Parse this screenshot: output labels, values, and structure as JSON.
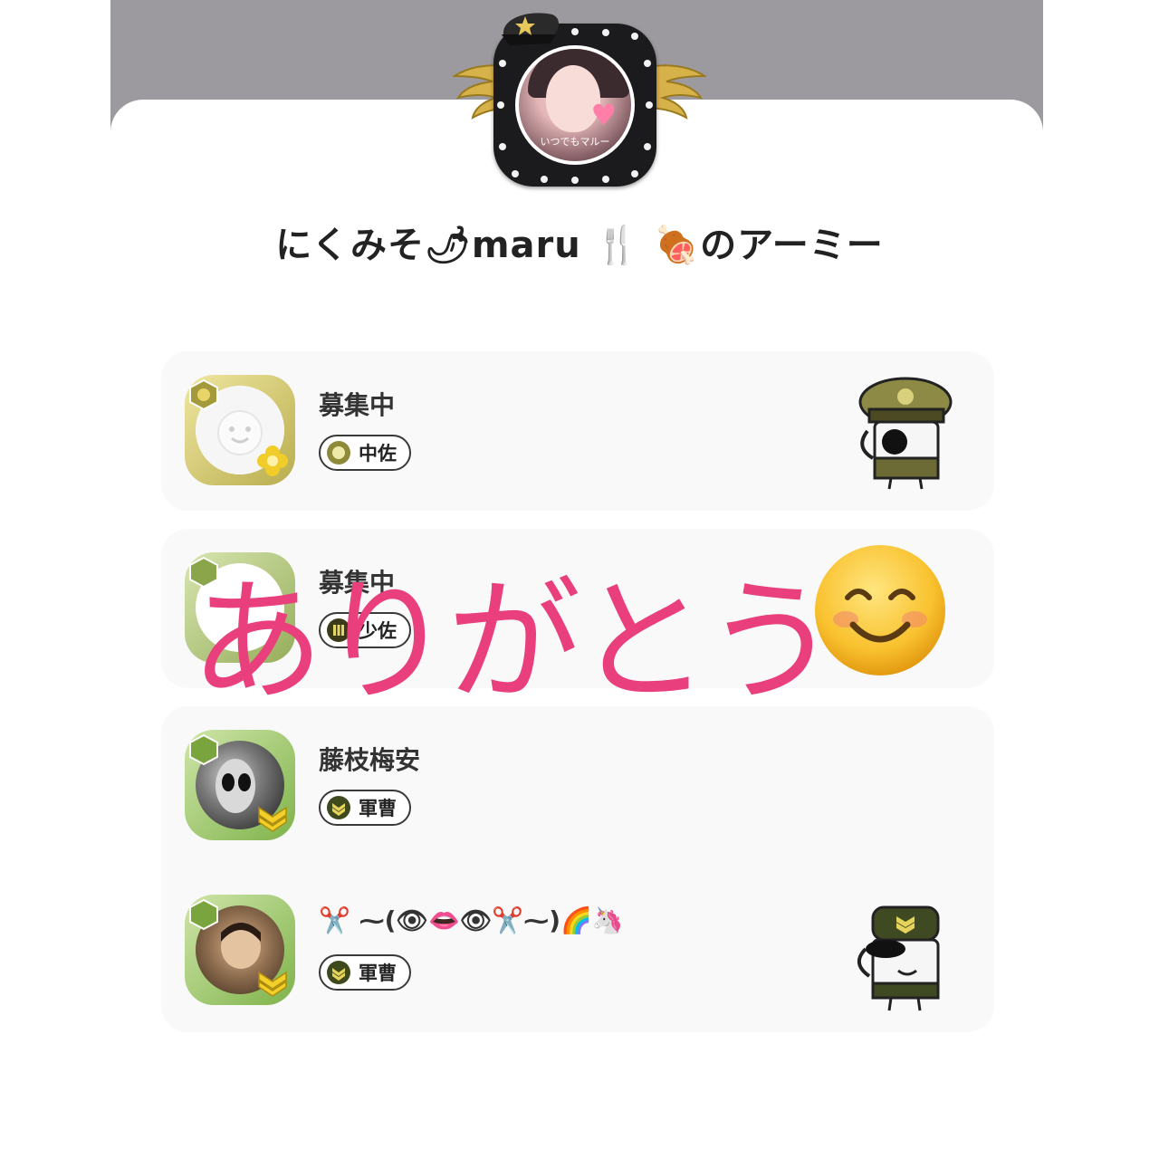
{
  "army_title": "にくみそ🌶maru 🍴 🍖のアーミー",
  "leader": {
    "avatar_caption": "いつでもマルー"
  },
  "members": [
    {
      "name": "募集中",
      "rank": "中佐"
    },
    {
      "name": "募集中",
      "rank": "少佐"
    },
    {
      "name": "藤枝梅安",
      "rank": "軍曹"
    },
    {
      "name": "✂️ ⁓(👁👄👁✂️⁓)🌈🦄",
      "rank": "軍曹"
    }
  ],
  "overlay_text": "ありがとう"
}
